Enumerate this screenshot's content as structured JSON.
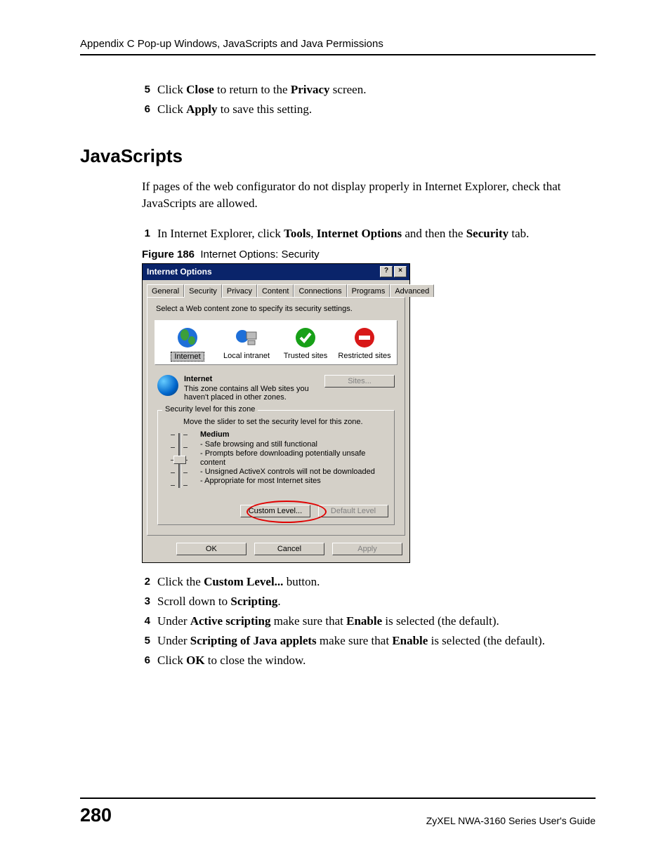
{
  "header": {
    "running": "Appendix C Pop-up Windows, JavaScripts and Java Permissions"
  },
  "top_steps": [
    {
      "n": "5",
      "pre": "Click ",
      "b1": "Close",
      "mid": " to return to the ",
      "b2": "Privacy",
      "post": " screen."
    },
    {
      "n": "6",
      "pre": "Click ",
      "b1": "Apply",
      "mid": " to save this setting.",
      "b2": "",
      "post": ""
    }
  ],
  "section_title": "JavaScripts",
  "intro": "If pages of the web configurator do not display properly in Internet Explorer, check that JavaScripts are allowed.",
  "step1": {
    "n": "1",
    "pre": "In Internet Explorer, click ",
    "b1": "Tools",
    "sep1": ", ",
    "b2": "Internet Options",
    "mid": " and then the ",
    "b3": "Security",
    "post": " tab."
  },
  "figure": {
    "label": "Figure 186",
    "caption": "Internet Options: Security"
  },
  "dialog": {
    "title": "Internet Options",
    "tabs": [
      "General",
      "Security",
      "Privacy",
      "Content",
      "Connections",
      "Programs",
      "Advanced"
    ],
    "active_tab": 1,
    "prompt": "Select a Web content zone to specify its security settings.",
    "zones": [
      {
        "label": "Internet",
        "selected": true,
        "icon": "globe"
      },
      {
        "label": "Local intranet",
        "selected": false,
        "icon": "intranet"
      },
      {
        "label": "Trusted sites",
        "selected": false,
        "icon": "check"
      },
      {
        "label": "Restricted sites",
        "selected": false,
        "icon": "minus"
      }
    ],
    "zone_detail_title": "Internet",
    "zone_detail_text": "This zone contains all Web sites you haven't placed in other zones.",
    "sites_button": "Sites...",
    "group_label": "Security level for this zone",
    "group_hint": "Move the slider to set the security level for this zone.",
    "level": "Medium",
    "bullets": [
      "- Safe browsing and still functional",
      "- Prompts before downloading potentially unsafe content",
      "- Unsigned ActiveX controls will not be downloaded",
      "- Appropriate for most Internet sites"
    ],
    "custom_btn": "Custom Level...",
    "default_btn": "Default Level",
    "ok": "OK",
    "cancel": "Cancel",
    "apply": "Apply"
  },
  "bottom_steps": [
    {
      "n": "2",
      "parts": [
        {
          "t": "Click the "
        },
        {
          "b": "Custom Level..."
        },
        {
          "t": " button."
        }
      ]
    },
    {
      "n": "3",
      "parts": [
        {
          "t": "Scroll down to "
        },
        {
          "b": "Scripting"
        },
        {
          "t": "."
        }
      ]
    },
    {
      "n": "4",
      "parts": [
        {
          "t": "Under "
        },
        {
          "b": "Active scripting"
        },
        {
          "t": " make sure that "
        },
        {
          "b": "Enable"
        },
        {
          "t": " is selected (the default)."
        }
      ]
    },
    {
      "n": "5",
      "parts": [
        {
          "t": "Under "
        },
        {
          "b": "Scripting of Java applets"
        },
        {
          "t": " make sure that "
        },
        {
          "b": "Enable"
        },
        {
          "t": " is selected (the default)."
        }
      ]
    },
    {
      "n": "6",
      "parts": [
        {
          "t": "Click "
        },
        {
          "b": "OK"
        },
        {
          "t": " to close the window."
        }
      ]
    }
  ],
  "footer": {
    "page": "280",
    "guide": "ZyXEL NWA-3160 Series User's Guide"
  }
}
